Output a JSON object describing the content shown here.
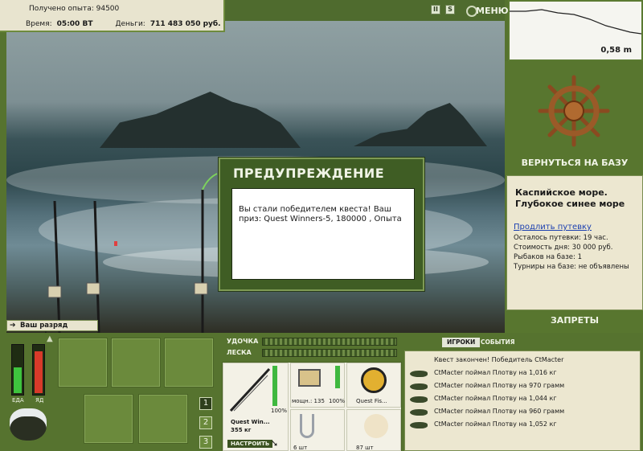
{
  "hud": {
    "xp_label": "Получено опыта:",
    "xp_value": "94500",
    "time_label": "Время:",
    "time_value": "05:00 ВТ",
    "money_label": "Деньги:",
    "money_value": "711 483 050 руб."
  },
  "system": {
    "pause_glyph": "II",
    "sound_glyph": "S",
    "menu_label": "МЕНЮ"
  },
  "depth": {
    "value": "0,58 m"
  },
  "location": {
    "return_label": "ВЕРНУТЬСЯ НА БАЗУ",
    "name": "Каспийское море. Глубокое синее море",
    "extend_link": "Продлить путевку",
    "left_label": "Осталось путевки: 19 час.",
    "cost_label": "Стоимость дня: 30 000 руб.",
    "fishers_label": "Рыбаков на базе: 1",
    "tournaments_label": "Турниры на базе: не объявлены",
    "bans_label": "ЗАПРЕТЫ"
  },
  "dialog": {
    "title": "ПРЕДУПРЕЖДЕНИЕ",
    "message": "Вы стали победителем квеста! Ваш приз: Quest Winners-5, 180000 , Опыта"
  },
  "toast": {
    "text": "Ваш разряд вырос!"
  },
  "status_gauges": {
    "food_label": "ЕДА",
    "food_level": 0.55,
    "poison_label": "ЯД",
    "poison_level": 0.9
  },
  "bag": {
    "pages": [
      "1",
      "2",
      "3"
    ],
    "active_page": "1"
  },
  "tackle": {
    "rod_label": "УДОЧКА",
    "line_label": "ЛЕСКА",
    "rod_name": "Quest Win...",
    "rod_weight": "355 кг",
    "rod_percent": "100%",
    "reel_power": "мощн.: 135",
    "reel_percent": "100%",
    "line_name": "Quest Fis...",
    "hook_count": "6 шт",
    "bait_count": "87 шт",
    "setup_button": "НАСТРОИТЬ"
  },
  "events": {
    "tabs": [
      "ИГРОКИ",
      "СОБЫТИЯ"
    ],
    "active_tab": "ИГРОКИ",
    "header": "Квест закончен! Победитель CtMacter",
    "items": [
      "CtMacter поймал Плотву на 1,016 кг",
      "CtMacter поймал Плотву на 970 грамм",
      "CtMacter поймал Плотву на 1,044 кг",
      "CtMacter поймал Плотву на 960 грамм",
      "CtMacter поймал Плотву на 1,052 кг"
    ]
  },
  "colors": {
    "panel_green": "#58762f",
    "panel_cream": "#ece7d0",
    "link_blue": "#1b3fb0",
    "text_light": "#f0f4e6"
  }
}
